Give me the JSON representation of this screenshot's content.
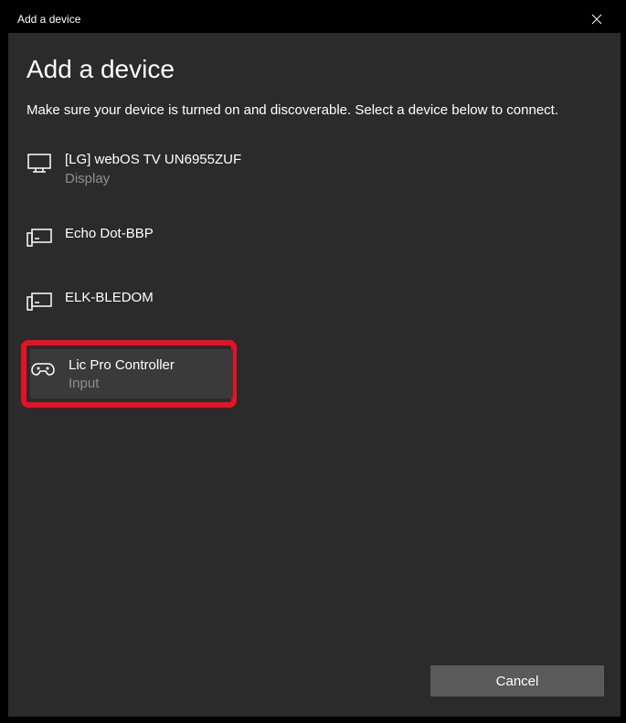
{
  "titlebar": {
    "text": "Add a device"
  },
  "main": {
    "heading": "Add a device",
    "subtext": "Make sure your device is turned on and discoverable. Select a device below to connect."
  },
  "devices": [
    {
      "name": "[LG] webOS TV UN6955ZUF",
      "type": "Display",
      "icon": "monitor"
    },
    {
      "name": "Echo Dot-BBP",
      "type": "",
      "icon": "device"
    },
    {
      "name": "ELK-BLEDOM",
      "type": "",
      "icon": "device"
    },
    {
      "name": "Lic Pro Controller",
      "type": "Input",
      "icon": "gamepad",
      "highlighted": true
    }
  ],
  "footer": {
    "cancel": "Cancel"
  }
}
